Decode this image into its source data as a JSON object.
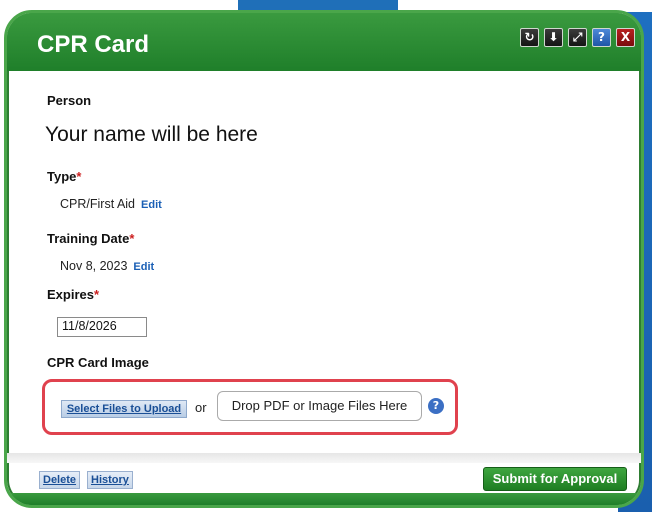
{
  "dialog": {
    "title": "CPR Card",
    "toolbar_icons": [
      "refresh-icon",
      "download-icon",
      "expand-icon",
      "help-icon",
      "close-icon"
    ],
    "toolbar_glyphs": [
      "↻",
      "⬇",
      "⤢",
      "?",
      "X"
    ]
  },
  "fields": {
    "person_label": "Person",
    "person_value": "Your name will be here",
    "type_label": "Type",
    "type_value": "CPR/First Aid",
    "type_edit": "Edit",
    "training_label": "Training Date",
    "training_value": "Nov 8, 2023",
    "training_edit": "Edit",
    "expires_label": "Expires",
    "expires_value": "11/8/2026",
    "image_label": "CPR Card Image",
    "required_mark": "*"
  },
  "upload": {
    "select_label": "Select Files to Upload",
    "or_text": "or",
    "drop_label": "Drop PDF or Image Files Here",
    "help_glyph": "?"
  },
  "footer": {
    "delete_label": "Delete",
    "history_label": "History",
    "submit_label": "Submit for Approval"
  },
  "colors": {
    "titlebar": "#2a8c33",
    "required": "#cc1f1f",
    "highlight": "#e0424e",
    "link": "#1a5fb5"
  }
}
